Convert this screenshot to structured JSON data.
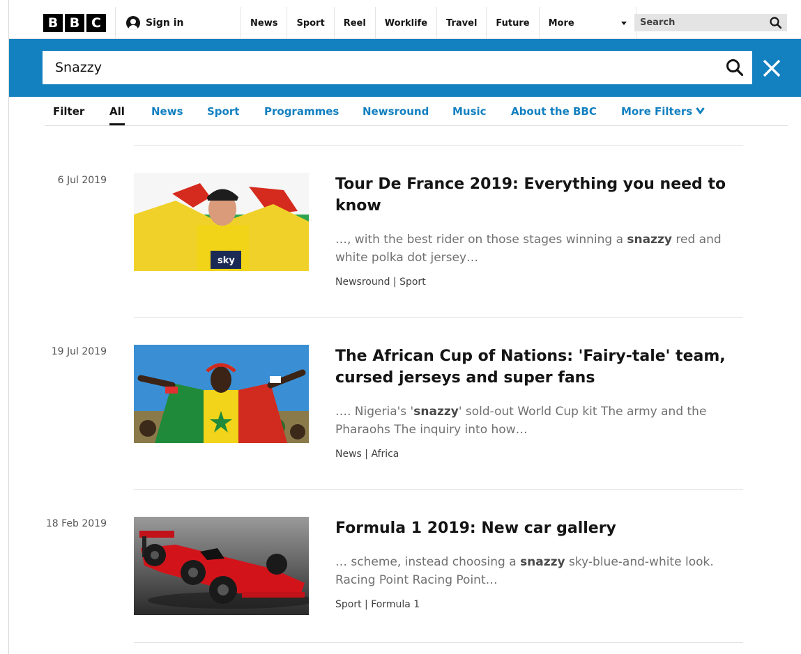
{
  "brand": {
    "letters": [
      "B",
      "B",
      "C"
    ]
  },
  "header": {
    "sign_in": "Sign in",
    "nav": [
      "News",
      "Sport",
      "Reel",
      "Worklife",
      "Travel",
      "Future"
    ],
    "more": "More",
    "search_label": "Search"
  },
  "search": {
    "query": "Snazzy"
  },
  "filters": {
    "label": "Filter",
    "tabs": [
      "All",
      "News",
      "Sport",
      "Programmes",
      "Newsround",
      "Music",
      "About the BBC",
      "More Filters"
    ],
    "active": "All"
  },
  "results": [
    {
      "date": "6 Jul 2019",
      "title": "Tour De France 2019: Everything you need to know",
      "snippet_before": "…, with the best rider on those stages winning a ",
      "snippet_bold": "snazzy",
      "snippet_after": " red and white polka dot jersey…",
      "tags": "Newsround | Sport"
    },
    {
      "date": "19 Jul 2019",
      "title": "The African Cup of Nations: 'Fairy-tale' team, cursed jerseys and super fans",
      "snippet_before": "…. Nigeria's '",
      "snippet_bold": "snazzy",
      "snippet_after": "' sold-out World Cup kit The army and the Pharaohs The inquiry into how…",
      "tags": "News | Africa"
    },
    {
      "date": "18 Feb 2019",
      "title": "Formula 1 2019: New car gallery",
      "snippet_before": "… scheme, instead choosing a ",
      "snippet_bold": "snazzy",
      "snippet_after": " sky-blue-and-white look. Racing Point Racing Point…",
      "tags": "Sport | Formula 1"
    }
  ],
  "colors": {
    "accent": "#1380c0",
    "text": "#141414",
    "muted": "#707070"
  }
}
